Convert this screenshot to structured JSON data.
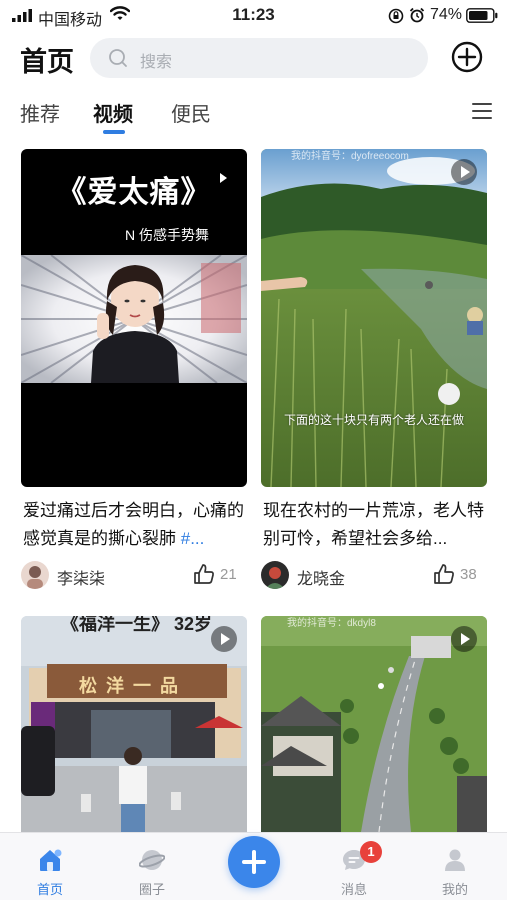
{
  "status_bar": {
    "carrier": "中国移动",
    "time": "11:23",
    "battery": "74%"
  },
  "header": {
    "title": "首页",
    "search_placeholder": "搜索",
    "icons": {
      "search": "search-icon",
      "add": "plus-circle-icon"
    }
  },
  "tabs": {
    "items": [
      {
        "label": "推荐"
      },
      {
        "label": "视频",
        "active": true
      },
      {
        "label": "便民"
      }
    ],
    "menu_icon": "hamburger-menu-icon"
  },
  "feed": [
    {
      "title_overlay": "《爱太痛》",
      "subtitle_overlay": "N 伤感手势舞",
      "caption_text": "爱过痛过后才会明白，心痛的感觉真是的撕心裂肺 ",
      "caption_tag": "#...",
      "author": "李柒柒",
      "likes": "21"
    },
    {
      "overlay_top": "我的抖音号：dyofreeocom",
      "overlay_text": "下面的这十块只有两个老人还在做",
      "caption": "现在农村的一片荒凉，老人特别可怜，希望社会多给...",
      "author": "龙晓金",
      "likes": "38"
    },
    {
      "overlay_head": "《福洋一生》 32岁",
      "sign_text": "松 洋 一 品"
    },
    {
      "overlay_top": "我的抖音号：dkdyl8"
    }
  ],
  "bottom_nav": {
    "items": [
      {
        "label": "首页",
        "icon": "home-icon",
        "active": true
      },
      {
        "label": "圈子",
        "icon": "planet-icon"
      },
      {
        "label": "",
        "icon": "plus-icon"
      },
      {
        "label": "消息",
        "icon": "chat-icon",
        "badge": "1"
      },
      {
        "label": "我的",
        "icon": "profile-icon"
      }
    ]
  },
  "colors": {
    "accent": "#2f7de1",
    "badge": "#e8413b"
  }
}
